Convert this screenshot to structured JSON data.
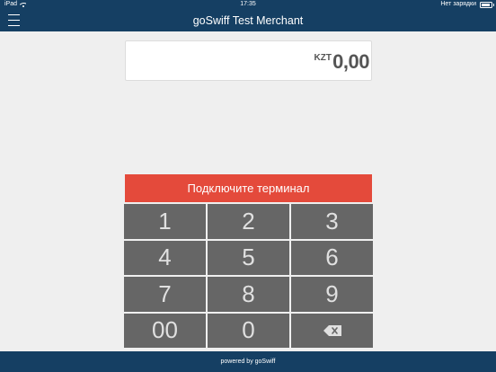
{
  "status_bar": {
    "device": "iPad",
    "time": "17:35",
    "battery_text": "Нет зарядки"
  },
  "header": {
    "title": "goSwiff Test Merchant"
  },
  "amount": {
    "currency": "KZT",
    "value": "0,00"
  },
  "connect_button": {
    "label": "Подключите терминал"
  },
  "keypad": {
    "keys": [
      "1",
      "2",
      "3",
      "4",
      "5",
      "6",
      "7",
      "8",
      "9",
      "00",
      "0"
    ],
    "backspace_icon": "backspace-icon"
  },
  "footer": {
    "text": "powered by goSwiff"
  },
  "colors": {
    "header_bg": "#153f63",
    "button_red": "#e44a3b",
    "key_bg": "#666666",
    "page_bg": "#efefef"
  }
}
